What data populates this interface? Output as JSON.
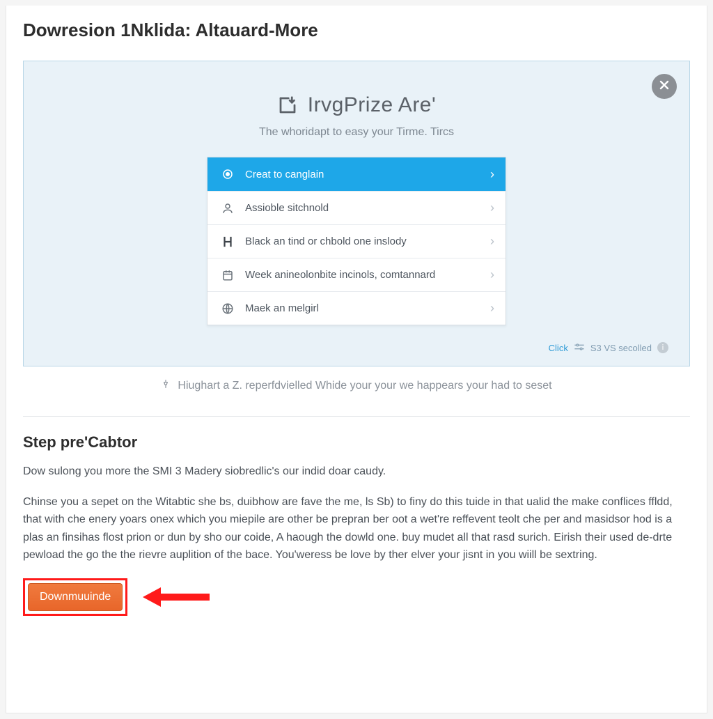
{
  "page": {
    "title": "Dowresion 1Nklida: Altauard-More"
  },
  "panel": {
    "brand": "IrvgPrize Are'",
    "subline": "The whoridapt to easy your Tirme. Tircs",
    "menu": [
      {
        "icon": "target-icon",
        "label": "Creat to canglain",
        "active": true
      },
      {
        "icon": "person-icon",
        "label": "Assioble sitchnold",
        "active": false
      },
      {
        "icon": "h-icon",
        "label": "Black an tind or chbold one inslody",
        "active": false
      },
      {
        "icon": "calendar-icon",
        "label": "Week anineolonbite incinols, comtannard",
        "active": false
      },
      {
        "icon": "globe-icon",
        "label": "Maek an melgirl",
        "active": false
      }
    ],
    "footer": {
      "click": "Click",
      "rest": "S3 VS secolled"
    }
  },
  "caption": "Hiughart a Z. reperfdvielled Whide your your we happears your had to seset",
  "step": {
    "title": "Step pre'Cabtor",
    "p1": "Dow sulong you more the SMI 3 Madery siobredlic's our indid doar caudy.",
    "p2": "Chinse you a sepet on the Witabtic she bs, duibhow are fave the me, ls Sb) to finy do this tuide in that ualid the make conflices ffldd, that with che enery yoars onex which you miepile are other be prepran ber oot a wet're reffevent teolt che per and masidsor hod is a plas an finsihas flost prion or dun by sho our coide, A haough the dowld one. buy mudet all that rasd surich.   Eirish their used de-drte pewload the go the the rievre auplition of the bace. You'weress be love by ther elver your jisnt in you wiill be sextring."
  },
  "cta": {
    "label": "Downmuuinde"
  }
}
